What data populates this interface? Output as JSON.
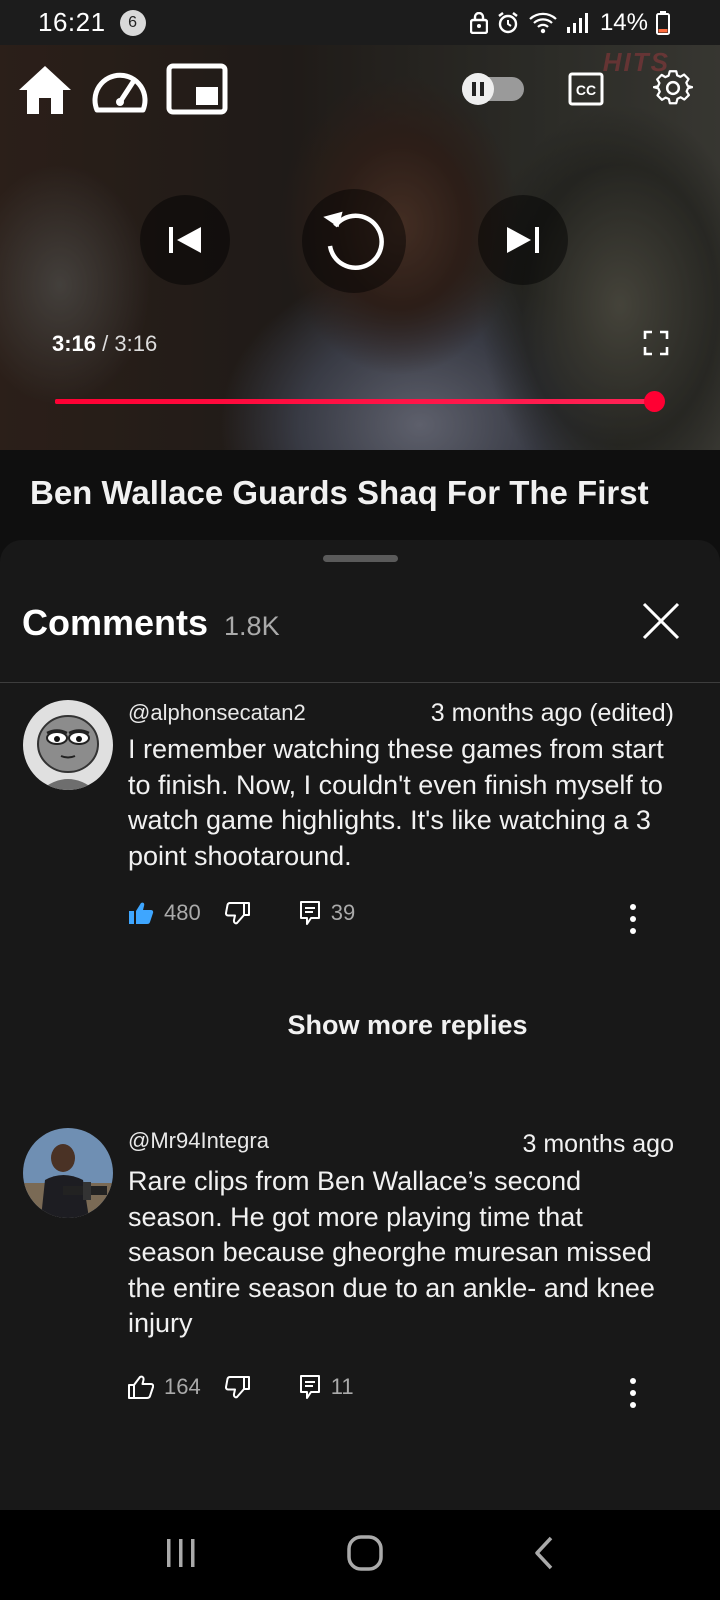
{
  "status_bar": {
    "time": "16:21",
    "notification_count": "6",
    "battery": "14%"
  },
  "player": {
    "current_time": "3:16",
    "separator": "/",
    "duration": "3:16",
    "progress_percent": 100,
    "watermark": "HITS",
    "icons": [
      "home-icon",
      "speed-icon",
      "miniplayer-icon",
      "autoplay-toggle",
      "captions-icon",
      "settings-icon",
      "previous-icon",
      "replay-icon",
      "next-icon",
      "fullscreen-icon"
    ],
    "accent_color": "#ff0033"
  },
  "video": {
    "title": "Ben Wallace Guards Shaq For The First"
  },
  "comments_panel": {
    "title": "Comments",
    "count": "1.8K",
    "show_more_replies": "Show more replies",
    "comments": [
      {
        "author": "@alphonsecatan2",
        "time": "3 months ago (edited)",
        "text": "I remember watching these games from start to finish. Now, I couldn't even finish myself to watch game highlights. It's like watching a 3 point shootaround.",
        "likes": "480",
        "replies": "39",
        "liked": true
      },
      {
        "author": "@Mr94Integra",
        "time": "3 months ago",
        "text": "Rare clips from Ben Wallace’s second season. He got more playing time that season because gheorghe muresan missed the entire season due to an ankle- and  knee injury",
        "likes": "164",
        "replies": "11",
        "liked": false
      }
    ]
  },
  "colors": {
    "like_active": "#3ea6ff",
    "background": "#0f0f0f"
  }
}
